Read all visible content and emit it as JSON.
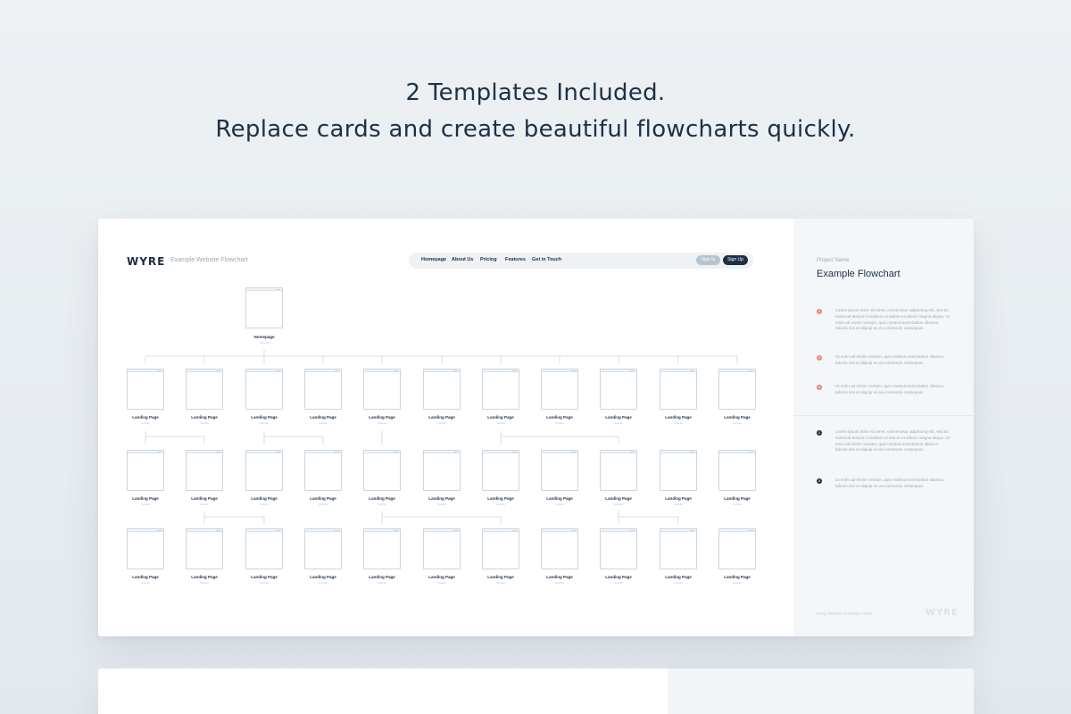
{
  "headline": {
    "line1": "2 Templates Included.",
    "line2": "Replace cards and create beautiful flowcharts quickly."
  },
  "flowchart": {
    "logo": "WYRE",
    "subtitle": "Example Website Flowchart",
    "nav": {
      "links": [
        "Homepage",
        "About Us",
        "Pricing",
        "Features",
        "Get in Touch"
      ],
      "sign_in": "Sign In",
      "sign_up": "Sign Up"
    },
    "home": {
      "label": "Homepage",
      "sub": "Subtitle"
    },
    "page_label": "Landing Page",
    "page_sub": "Subtitle",
    "rows": 3,
    "columns": 11
  },
  "sidepanel": {
    "project_label": "Project Name",
    "project_name": "Example Flowchart",
    "notes_red": [
      {
        "num": "1",
        "text": "Lorem ipsum dolor sit amet, consectetur adipiscing elit, sed do eiusmod tempor incididunt ut labore et dolore magna aliqua. Ut enim ad minim veniam, quis nostrud exercitation ullamco laboris nisi ut aliquip ex ea commodo consequat."
      },
      {
        "num": "2",
        "text": "Ut enim ad minim veniam, quis nostrud exercitation ullamco laboris nisi ut aliquip ex ea commodo consequat."
      },
      {
        "num": "3",
        "text": "Ut enim ad minim veniam, quis nostrud exercitation ullamco laboris nisi ut aliquip ex ea commodo consequat."
      }
    ],
    "notes_dark": [
      {
        "num": "1",
        "text": "Lorem ipsum dolor sit amet, consectetur adipiscing elit, sed do eiusmod tempor incididunt ut labore et dolore magna aliqua. Ut enim ad minim veniam, quis nostrud exercitation ullamco laboris nisi ut aliquip ex ea commodo consequat."
      },
      {
        "num": "2",
        "text": "Ut enim ad minim veniam, quis nostrud exercitation ullamco laboris nisi ut aliquip ex ea commodo consequat."
      }
    ],
    "footer_text": "Pixey Website Flowchart Cards",
    "footer_logo": "WYRE"
  },
  "colors": {
    "accent_dark": "#1c2f44",
    "note_red": "#f0837a",
    "card_border": "#c9d6e0"
  }
}
